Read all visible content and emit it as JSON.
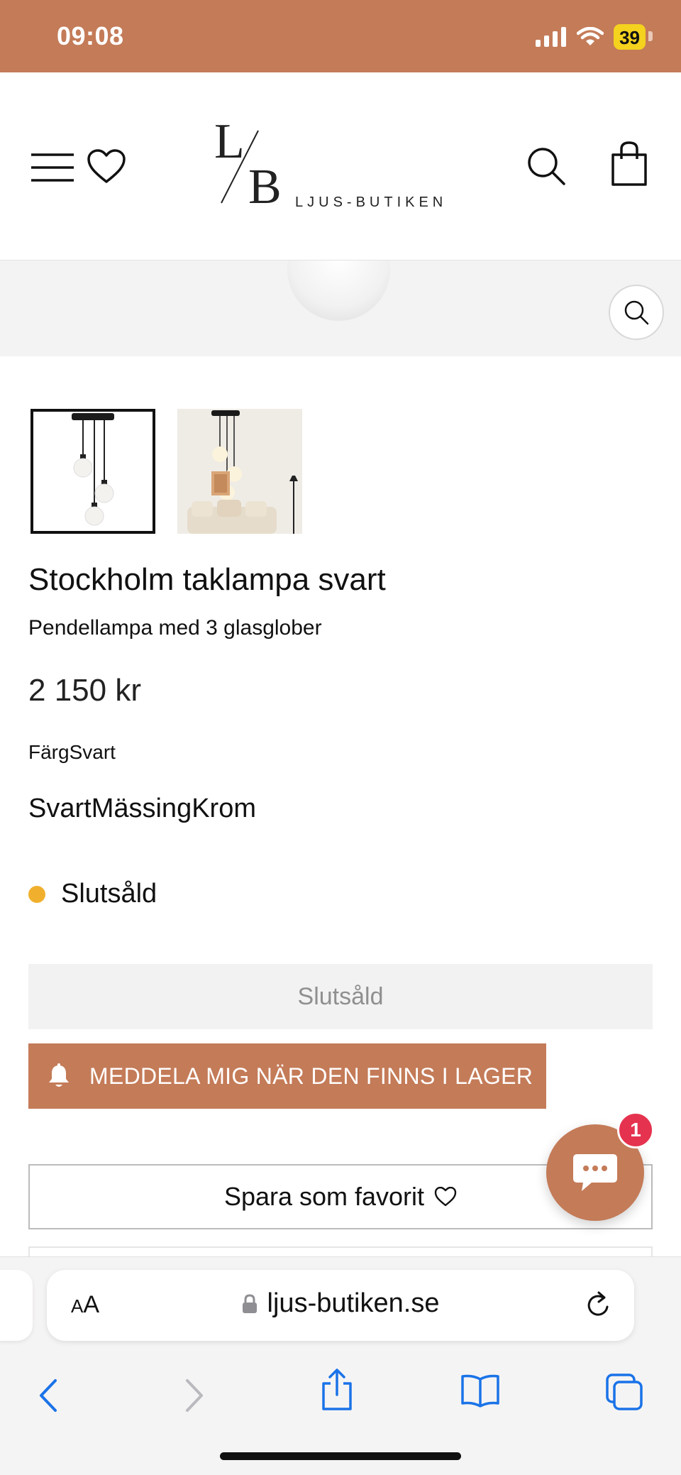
{
  "status_bar": {
    "time": "09:08",
    "battery": "39"
  },
  "header": {
    "logo_text": "LJUS-BUTIKEN"
  },
  "product": {
    "title": "Stockholm taklampa svart",
    "subtitle": "Pendellampa med 3 glasglober",
    "price": "2 150 kr",
    "color_label": "FärgSvart",
    "color_options": [
      "Svart",
      "Mässing",
      "Krom"
    ],
    "stock_status": "Slutsåld",
    "sold_out_button": "Slutsåld",
    "notify_button": "MEDDELA MIG NÄR DEN FINNS I LAGER",
    "favorite_button": "Spara som favorit"
  },
  "chat": {
    "badge_count": "1"
  },
  "browser": {
    "aa_small": "A",
    "aa_large": "A",
    "url": "ljus-butiken.se"
  },
  "colors": {
    "brand": "#c47b58",
    "stock_dot": "#f0b02d",
    "badge": "#e5334f",
    "ios_blue": "#1a73e8"
  }
}
